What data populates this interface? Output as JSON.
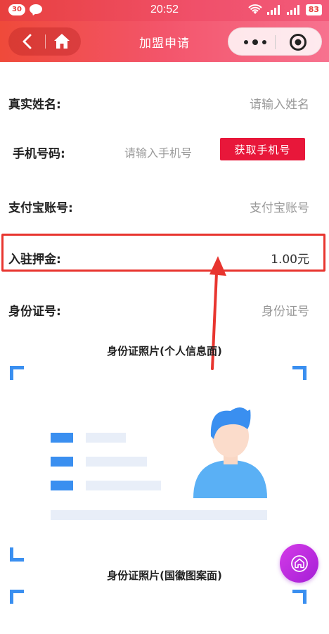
{
  "status_bar": {
    "notification_count": "30",
    "time": "20:52",
    "battery": "83",
    "icons": [
      "chat-icon",
      "wifi-icon",
      "signal-icon",
      "signal-icon",
      "battery-icon"
    ]
  },
  "nav": {
    "title": "加盟申请",
    "icons": [
      "back-icon",
      "home-icon",
      "more-icon",
      "close-target-icon"
    ]
  },
  "form": {
    "name_label": "真实姓名:",
    "name_placeholder": "请输入姓名",
    "phone_label": "手机号码:",
    "phone_placeholder": "请输入手机号",
    "phone_button": "获取手机号",
    "alipay_label": "支付宝账号:",
    "alipay_placeholder": "支付宝账号",
    "deposit_label": "入驻押金:",
    "deposit_value": "1.00元",
    "idno_label": "身份证号:",
    "idno_placeholder": "身份证号"
  },
  "photos": {
    "front_title": "身份证照片(个人信息面)",
    "back_title": "身份证照片(国徽图案面)"
  },
  "colors": {
    "accent_red": "#e8173a",
    "highlight_red": "#e8352f",
    "corner_blue": "#3a8ff0",
    "float_purple": "#c02fe0"
  }
}
